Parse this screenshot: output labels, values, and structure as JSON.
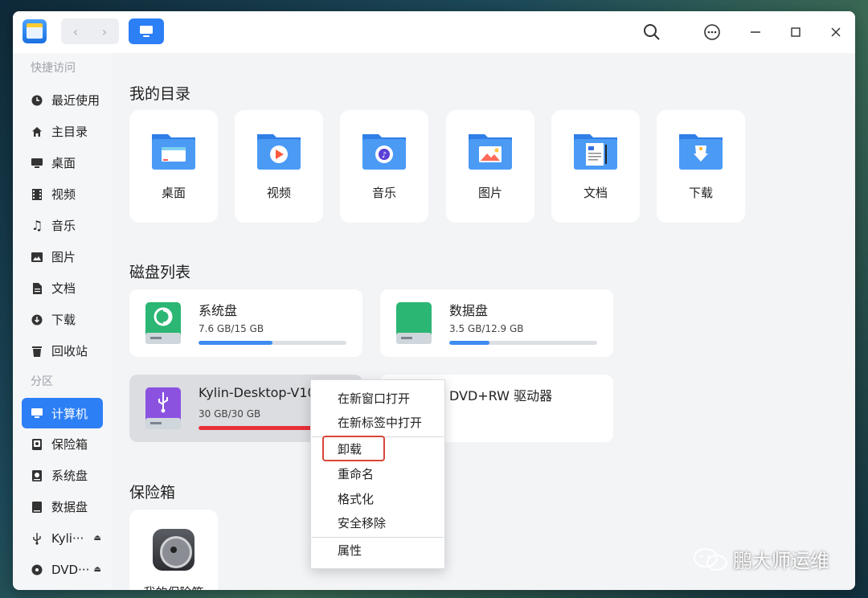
{
  "window": {
    "view_mode_icon": "computer-icon",
    "titlebar_icons": [
      "search-icon",
      "more-icon",
      "minimize-icon",
      "maximize-icon",
      "close-icon"
    ]
  },
  "sidebar": {
    "quick_access_label": "快捷访问",
    "quick_items": [
      {
        "label": "最近使用",
        "icon": "clock-icon"
      },
      {
        "label": "主目录",
        "icon": "home-icon"
      },
      {
        "label": "桌面",
        "icon": "desktop-icon"
      },
      {
        "label": "视频",
        "icon": "video-icon"
      },
      {
        "label": "音乐",
        "icon": "music-icon"
      },
      {
        "label": "图片",
        "icon": "image-icon"
      },
      {
        "label": "文档",
        "icon": "document-icon"
      },
      {
        "label": "下载",
        "icon": "download-icon"
      },
      {
        "label": "回收站",
        "icon": "trash-icon"
      }
    ],
    "partition_label": "分区",
    "partition_items": [
      {
        "label": "计算机",
        "icon": "computer-icon",
        "active": true
      },
      {
        "label": "保险箱",
        "icon": "safe-icon"
      },
      {
        "label": "系统盘",
        "icon": "disk-icon"
      },
      {
        "label": "数据盘",
        "icon": "disk-icon"
      },
      {
        "label": "Kyli···",
        "icon": "usb-icon",
        "eject": "⏏"
      },
      {
        "label": "DVD···",
        "icon": "disc-icon",
        "eject": "⏏"
      }
    ]
  },
  "main": {
    "my_dirs_title": "我的目录",
    "dirs": [
      {
        "label": "桌面",
        "icon": "desktop-folder-icon"
      },
      {
        "label": "视频",
        "icon": "video-folder-icon"
      },
      {
        "label": "音乐",
        "icon": "music-folder-icon"
      },
      {
        "label": "图片",
        "icon": "image-folder-icon"
      },
      {
        "label": "文档",
        "icon": "document-folder-icon"
      },
      {
        "label": "下载",
        "icon": "download-folder-icon"
      }
    ],
    "disk_list_title": "磁盘列表",
    "disks": [
      {
        "name": "系统盘",
        "size": "7.6 GB/15 GB",
        "usage": 0.5
      },
      {
        "name": "数据盘",
        "size": "3.5 GB/12.9 GB",
        "usage": 0.27
      },
      {
        "name": "Kylin-Desktop-V10",
        "size": "30 GB/30 GB",
        "usage": 1.0
      },
      {
        "name": "DVD+RW 驱动器",
        "size": "",
        "usage": 0
      }
    ],
    "vault_title": "保险箱",
    "vault_label": "我的保险箱"
  },
  "context_menu": {
    "items": [
      "在新窗口打开",
      "在新标签中打开",
      "卸载",
      "重命名",
      "格式化",
      "安全移除",
      "属性"
    ]
  },
  "watermark": "鹏大师运维",
  "colors": {
    "accent": "#2d7ff5",
    "full_disk": "#e8303a",
    "highlight": "#d9453a"
  }
}
